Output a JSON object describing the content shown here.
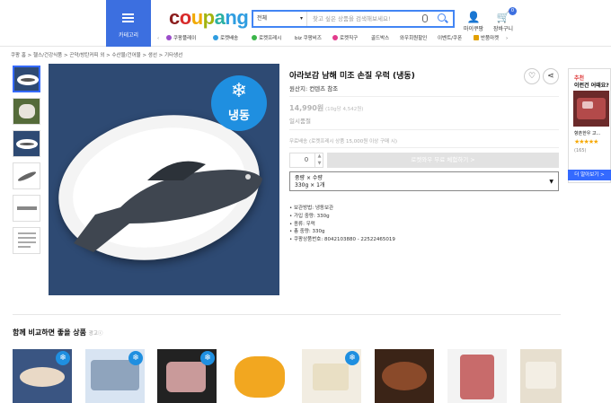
{
  "header": {
    "category_label": "카테고리",
    "logo": [
      {
        "ch": "c",
        "color": "#8b1e1e"
      },
      {
        "ch": "o",
        "color": "#d82b2b"
      },
      {
        "ch": "u",
        "color": "#f2a900"
      },
      {
        "ch": "p",
        "color": "#a2b40f"
      },
      {
        "ch": "a",
        "color": "#2bb0a2"
      },
      {
        "ch": "n",
        "color": "#2f9de0"
      },
      {
        "ch": "g",
        "color": "#2f9de0"
      }
    ],
    "search_category": "전체",
    "search_placeholder": "찾고 싶은 상품을 검색해보세요!",
    "mypage_label": "마이쿠팡",
    "cart_label": "장바구니",
    "cart_count": "0"
  },
  "services": [
    "쿠팡플레이",
    "로켓배송",
    "로켓프레시",
    "biz 쿠팡비즈",
    "로켓직구",
    "골드박스",
    "와우회원할인",
    "이벤트/쿠폰",
    "반품마켓"
  ],
  "breadcrumb": "쿠팡 홈 > 헬스/건강식품 > 곤약/방탄커피 외 > 수산물/건어물 > 생선 > 기타생선",
  "product": {
    "title": "아라보감 남해 미조 손질 우럭 (냉동)",
    "origin": "원산지: 컨텐츠 참조",
    "price": "14,990원",
    "unit_price": "(10g당 4,542원)",
    "sold_out": "일시품절",
    "shipping": "무료배송 (로켓프레시 상품 15,000원 이상 구매 시)",
    "quantity": "0",
    "buy_button": "로켓와우 무료 체험하기 >",
    "option_label": "중량 × 수량",
    "option_value": "330g × 1개",
    "frozen_badge": "냉동",
    "specs": [
      "보관방법: 냉동보관",
      "가입 중량: 330g",
      "종류: 우럭",
      "총 중량: 330g",
      "쿠팡상품번호: 8042103880 - 22522465019"
    ]
  },
  "sidebar_rec": {
    "label1": "추천",
    "label2": "이런건 어때요?",
    "name": "향촌한우 고...",
    "stars": "★★★★★",
    "count": "(165)",
    "more_button": "더 알아보기 >"
  },
  "compare_section": {
    "title": "함께 비교하면 좋을 상품",
    "ad": "광고ⓘ"
  },
  "colors": {
    "accent": "#346aff",
    "frozen": "#1f8fe0"
  }
}
